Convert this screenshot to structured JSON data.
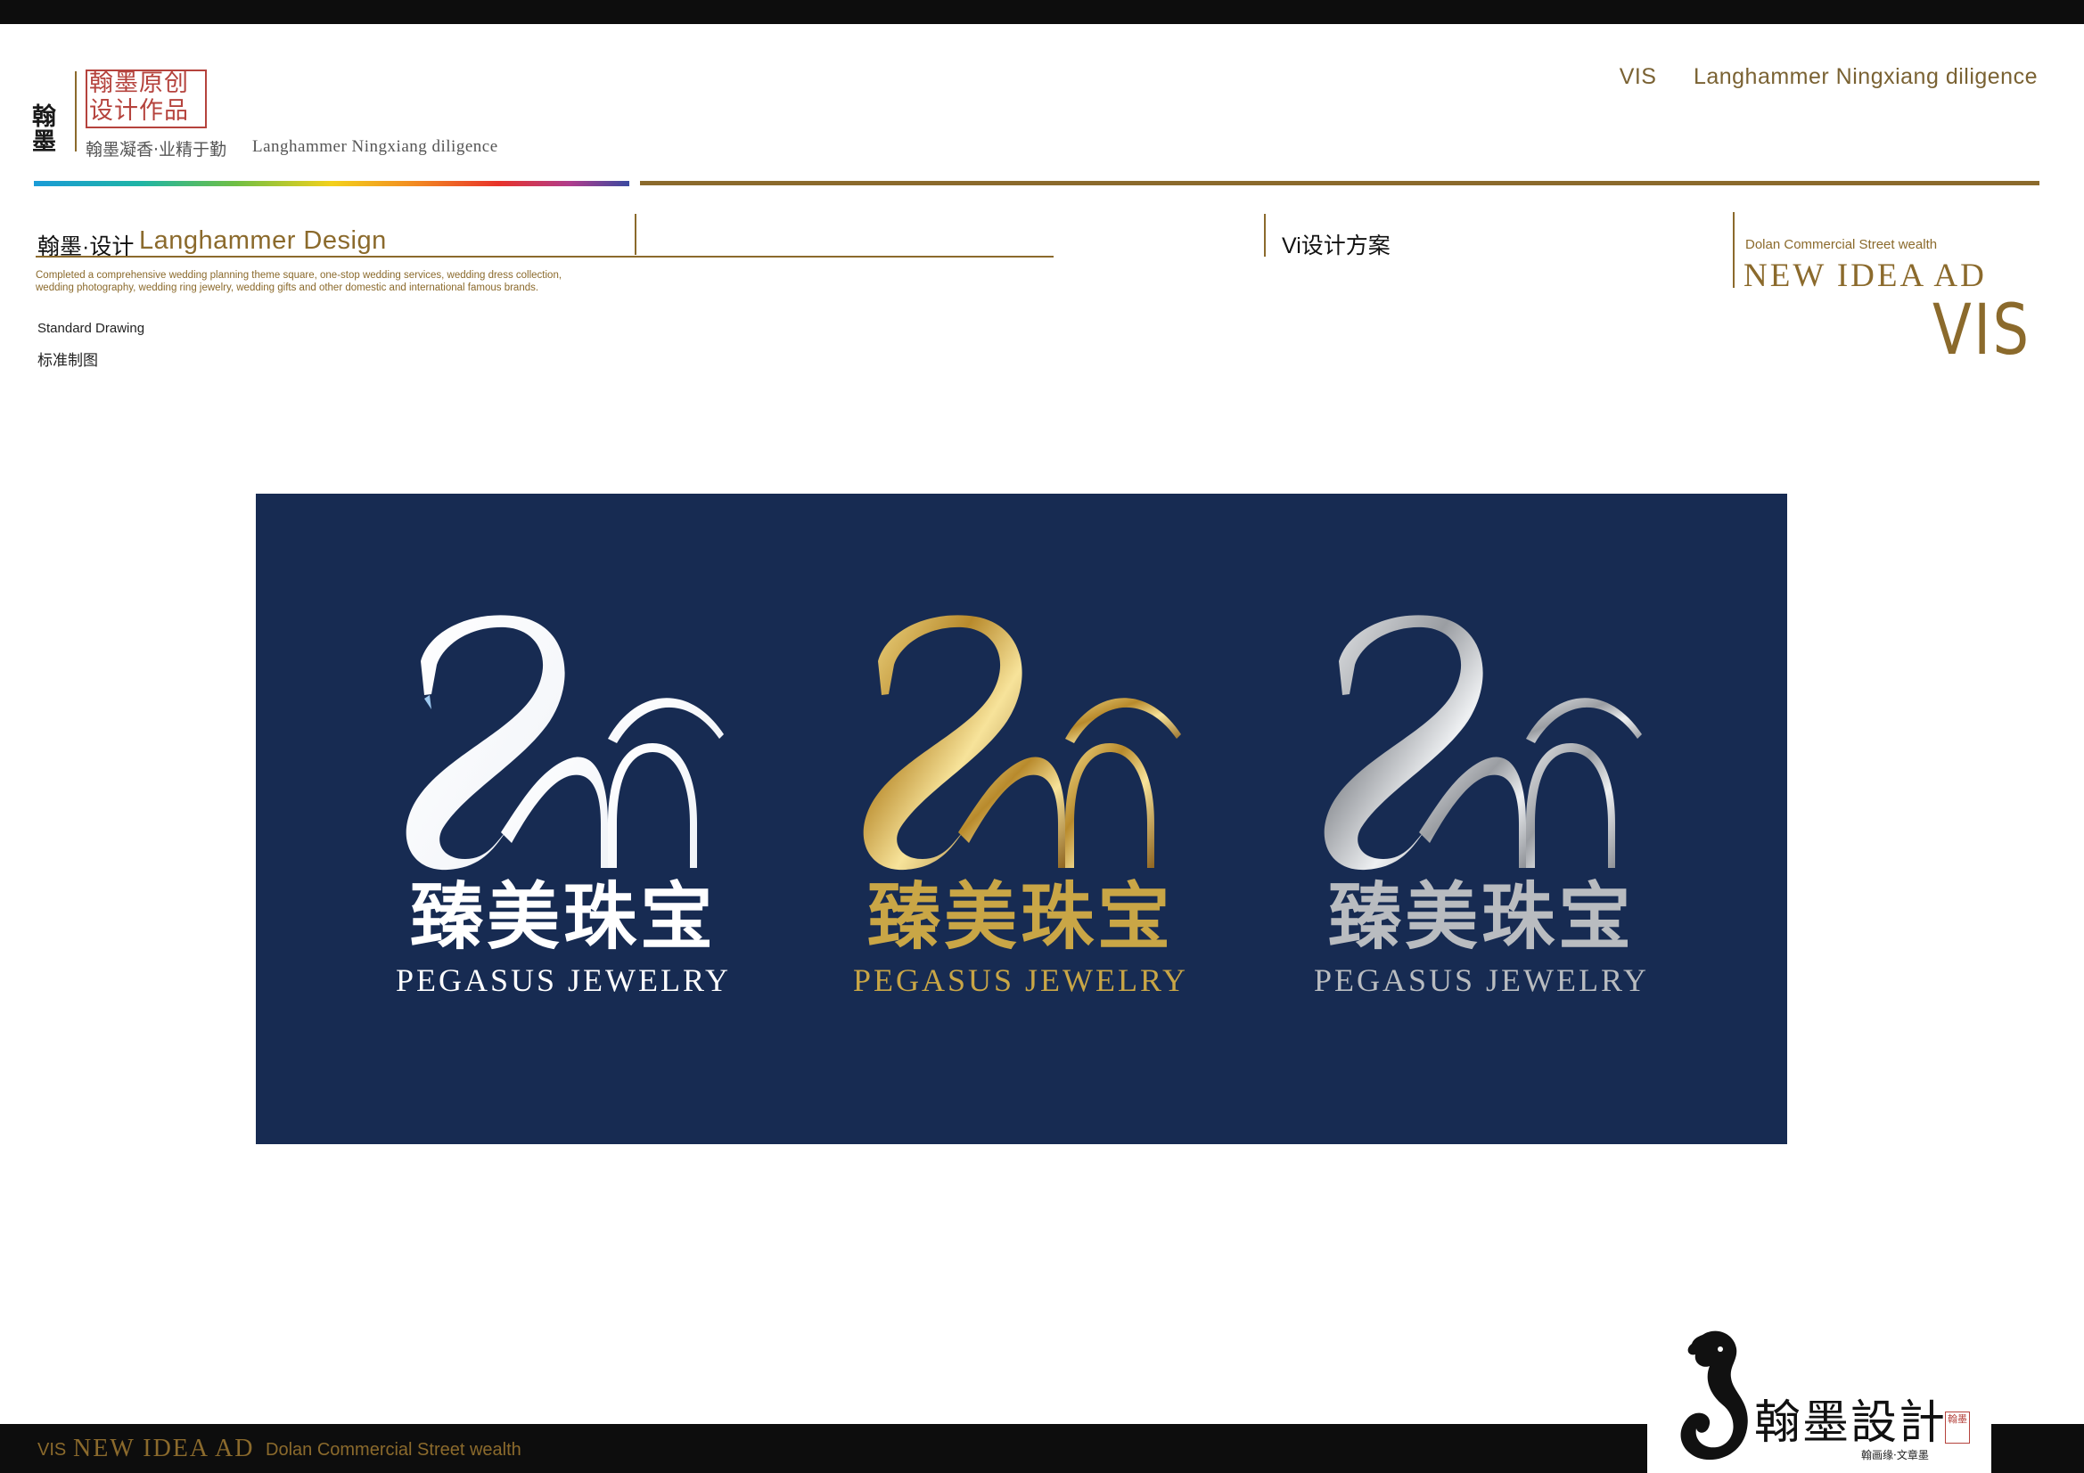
{
  "header": {
    "seal_vertical": "翰墨",
    "seal_box": "翰墨原创\n设计作品",
    "slogan_cn": "翰墨凝香·业精于勤",
    "slogan_en": "Langhammer Ningxiang diligence",
    "top_right_vis": "VIS",
    "top_right_title": "Langhammer Ningxiang diligence"
  },
  "section": {
    "title_cn": "翰墨·设计",
    "title_en": "Langhammer Design",
    "description": "Completed a comprehensive wedding planning theme square, one-stop wedding services, wedding dress collection, wedding photography, wedding ring jewelry, wedding gifts and other domestic and international famous brands.",
    "standard_en": "Standard Drawing",
    "standard_cn": "标准制图",
    "vi_label": "Vi设计方案",
    "right_small": "Dolan Commercial Street wealth",
    "right_idea": "NEW IDEA AD",
    "right_vis": "VIS"
  },
  "logos": [
    {
      "variant": "white",
      "name_cn": "臻美珠宝",
      "name_en": "PEGASUS JEWELRY",
      "color": "#ffffff"
    },
    {
      "variant": "gold",
      "name_cn": "臻美珠宝",
      "name_en": "PEGASUS JEWELRY",
      "color": "#c9a646"
    },
    {
      "variant": "silver",
      "name_cn": "臻美珠宝",
      "name_en": "PEGASUS JEWELRY",
      "color": "#b9bcc0"
    }
  ],
  "panel_color": "#172b52",
  "accent_gold": "#8b6a2c",
  "footer": {
    "vis": "VIS",
    "idea": "NEW IDEA AD",
    "dolan": "Dolan Commercial Street wealth",
    "logo_text": "翰墨設計",
    "logo_sub": "翰画缘·文章墨",
    "logo_seal": "翰墨"
  }
}
